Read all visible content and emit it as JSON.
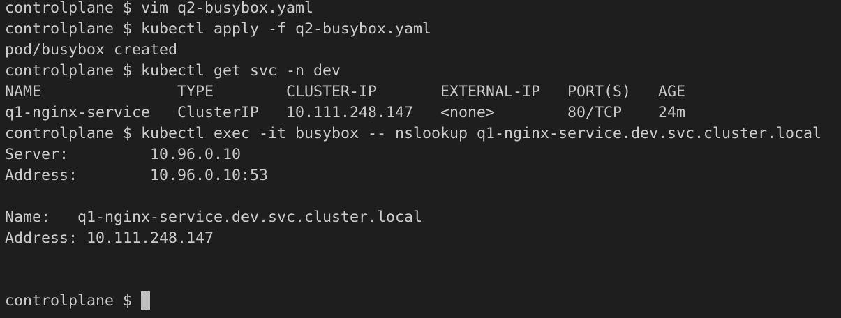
{
  "terminal": {
    "lines": [
      "controlplane $ vim q2-busybox.yaml",
      "controlplane $ kubectl apply -f q2-busybox.yaml",
      "pod/busybox created",
      "controlplane $ kubectl get svc -n dev",
      "NAME               TYPE        CLUSTER-IP       EXTERNAL-IP   PORT(S)   AGE",
      "q1-nginx-service   ClusterIP   10.111.248.147   <none>        80/TCP    24m",
      "controlplane $ kubectl exec -it busybox -- nslookup q1-nginx-service.dev.svc.cluster.local",
      "Server:         10.96.0.10",
      "Address:        10.96.0.10:53",
      "",
      "Name:   q1-nginx-service.dev.svc.cluster.local",
      "Address: 10.111.248.147",
      "",
      "",
      "controlplane $ "
    ],
    "colors": {
      "background": "#1e1e1e",
      "foreground": "#cccccc",
      "cursor": "#bfbfbf"
    }
  }
}
